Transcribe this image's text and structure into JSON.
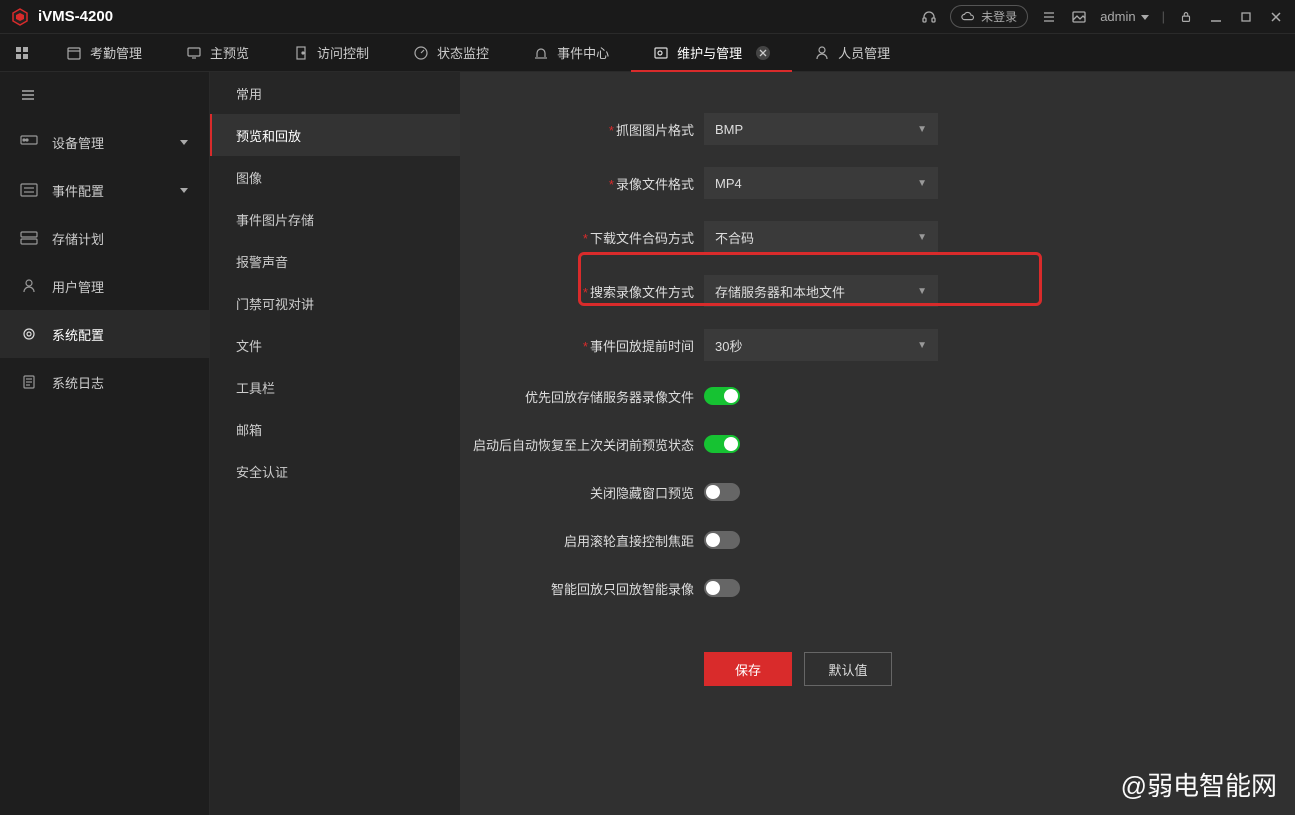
{
  "app": {
    "title": "iVMS-4200"
  },
  "titlebar": {
    "cloud_status": "未登录",
    "user": "admin"
  },
  "tabs": [
    {
      "label": "考勤管理"
    },
    {
      "label": "主预览"
    },
    {
      "label": "访问控制"
    },
    {
      "label": "状态监控"
    },
    {
      "label": "事件中心"
    },
    {
      "label": "维护与管理",
      "active": true,
      "closable": true
    },
    {
      "label": "人员管理"
    }
  ],
  "sidebar1": [
    {
      "label": "设备管理",
      "expandable": true
    },
    {
      "label": "事件配置",
      "expandable": true
    },
    {
      "label": "存储计划"
    },
    {
      "label": "用户管理"
    },
    {
      "label": "系统配置",
      "active": true
    },
    {
      "label": "系统日志"
    }
  ],
  "sidebar2": [
    {
      "label": "常用"
    },
    {
      "label": "预览和回放",
      "active": true
    },
    {
      "label": "图像"
    },
    {
      "label": "事件图片存储"
    },
    {
      "label": "报警声音"
    },
    {
      "label": "门禁可视对讲"
    },
    {
      "label": "文件"
    },
    {
      "label": "工具栏"
    },
    {
      "label": "邮箱"
    },
    {
      "label": "安全认证"
    }
  ],
  "form": {
    "capture_format": {
      "label": "抓图图片格式",
      "value": "BMP",
      "required": true
    },
    "record_format": {
      "label": "录像文件格式",
      "value": "MP4",
      "required": true
    },
    "download_merge": {
      "label": "下载文件合码方式",
      "value": "不合码",
      "required": true
    },
    "search_mode": {
      "label": "搜索录像文件方式",
      "value": "存储服务器和本地文件",
      "required": true,
      "highlighted": true
    },
    "pre_play": {
      "label": "事件回放提前时间",
      "value": "30秒",
      "required": true
    }
  },
  "toggles": {
    "priority_playback": {
      "label": "优先回放存储服务器录像文件",
      "on": true
    },
    "restore_state": {
      "label": "启动后自动恢复至上次关闭前预览状态",
      "on": true
    },
    "close_hidden": {
      "label": "关闭隐藏窗口预览",
      "on": false
    },
    "scroll_focus": {
      "label": "启用滚轮直接控制焦距",
      "on": false
    },
    "smart_only": {
      "label": "智能回放只回放智能录像",
      "on": false
    }
  },
  "buttons": {
    "save": "保存",
    "defaults": "默认值"
  },
  "watermark": "@弱电智能网"
}
